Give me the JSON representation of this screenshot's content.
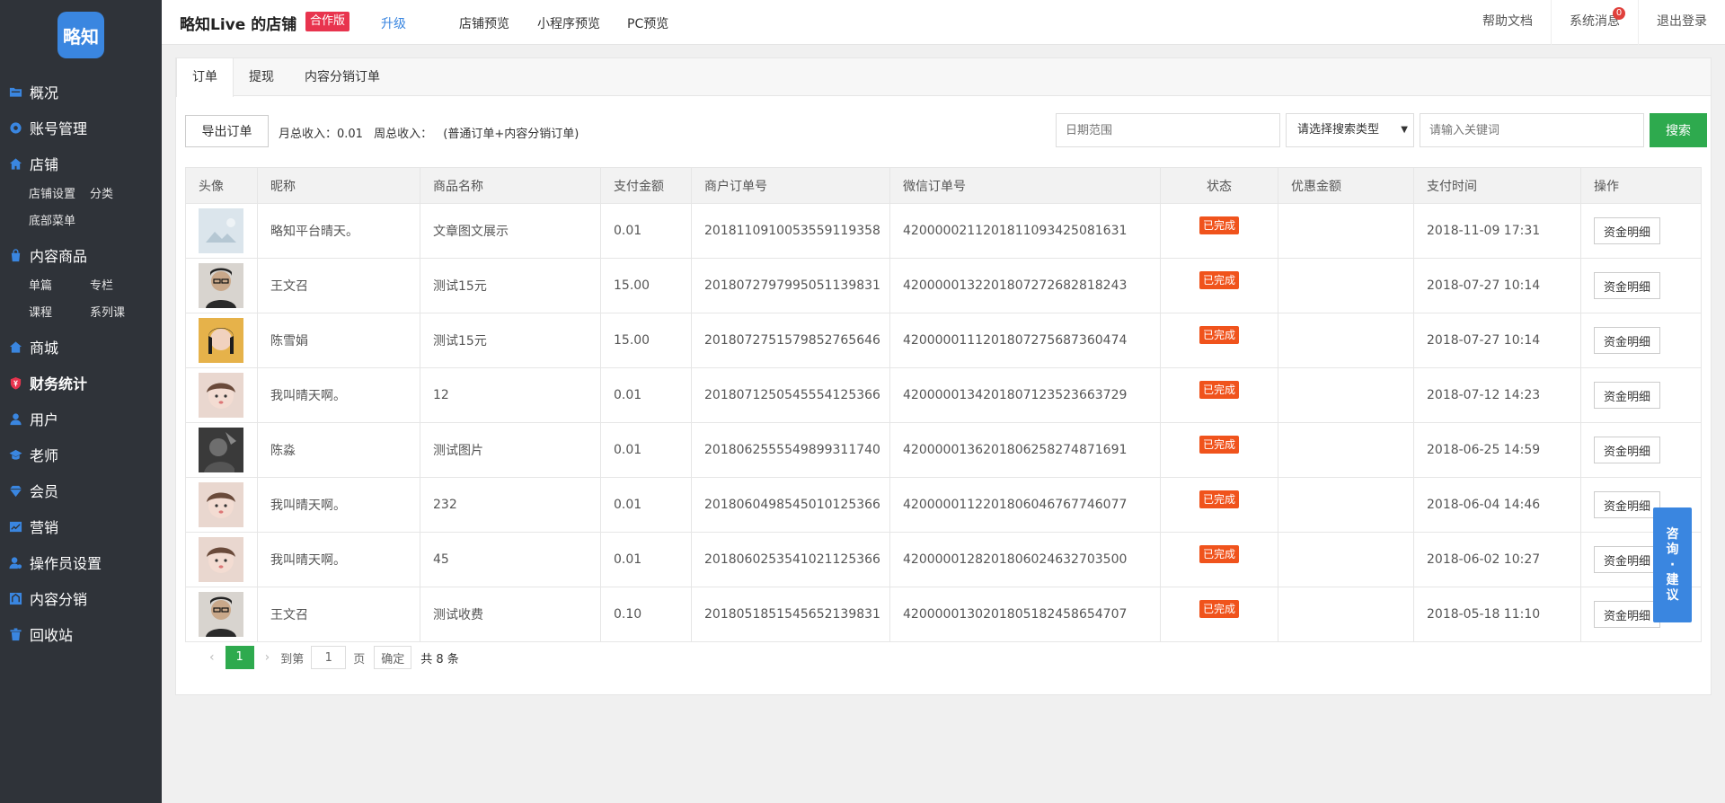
{
  "logo": {
    "text": "略知"
  },
  "sidebar": {
    "items": [
      {
        "label": "概况"
      },
      {
        "label": "账号管理"
      },
      {
        "label": "店铺"
      },
      {
        "label": "内容商品"
      },
      {
        "label": "商城"
      },
      {
        "label": "财务统计"
      },
      {
        "label": "用户"
      },
      {
        "label": "老师"
      },
      {
        "label": "会员"
      },
      {
        "label": "营销"
      },
      {
        "label": "操作员设置"
      },
      {
        "label": "内容分销"
      },
      {
        "label": "回收站"
      }
    ],
    "shop_sub": [
      "店铺设置",
      "分类",
      "底部菜单"
    ],
    "content_sub": [
      "单篇",
      "专栏",
      "课程",
      "系列课"
    ]
  },
  "header": {
    "shop_name": "略知Live 的店铺",
    "badge": "合作版",
    "upgrade": "升级",
    "nav": [
      "店铺预览",
      "小程序预览",
      "PC预览"
    ],
    "help": "帮助文档",
    "messages": "系统消息",
    "message_count": "0",
    "logout": "退出登录"
  },
  "tabs": [
    "订单",
    "提现",
    "内容分销订单"
  ],
  "toolbar": {
    "export": "导出订单",
    "monthly_income": "月总收入：0.01",
    "weekly_income": "周总收入：",
    "note": "(普通订单+内容分销订单)",
    "date_placeholder": "日期范围",
    "search_type": "请选择搜索类型",
    "keyword_placeholder": "请输入关键词",
    "search": "搜索"
  },
  "table": {
    "headers": [
      "头像",
      "昵称",
      "商品名称",
      "支付金额",
      "商户订单号",
      "微信订单号",
      "状态",
      "优惠金额",
      "支付时间",
      "操作"
    ],
    "detail_label": "资金明细",
    "rows": [
      {
        "nickname": "略知平台晴天。",
        "product": "文章图文展示",
        "amount": "0.01",
        "merchant_no": "2018110910053559119358",
        "wechat_no": "4200000211201811093425081631",
        "status": "已完成",
        "discount": "",
        "time": "2018-11-09 17:31"
      },
      {
        "nickname": "王文召",
        "product": "测试15元",
        "amount": "15.00",
        "merchant_no": "2018072797995051139831",
        "wechat_no": "4200000132201807272682818243",
        "status": "已完成",
        "discount": "",
        "time": "2018-07-27 10:14"
      },
      {
        "nickname": "陈雪娟",
        "product": "测试15元",
        "amount": "15.00",
        "merchant_no": "2018072751579852765646",
        "wechat_no": "4200000111201807275687360474",
        "status": "已完成",
        "discount": "",
        "time": "2018-07-27 10:14"
      },
      {
        "nickname": "我叫晴天啊。",
        "product": "12",
        "amount": "0.01",
        "merchant_no": "2018071250545554125366",
        "wechat_no": "4200000134201807123523663729",
        "status": "已完成",
        "discount": "",
        "time": "2018-07-12 14:23"
      },
      {
        "nickname": "陈淼",
        "product": "测试图片",
        "amount": "0.01",
        "merchant_no": "2018062555549899311740",
        "wechat_no": "4200000136201806258274871691",
        "status": "已完成",
        "discount": "",
        "time": "2018-06-25 14:59"
      },
      {
        "nickname": "我叫晴天啊。",
        "product": "232",
        "amount": "0.01",
        "merchant_no": "2018060498545010125366",
        "wechat_no": "4200000112201806046767746077",
        "status": "已完成",
        "discount": "",
        "time": "2018-06-04 14:46"
      },
      {
        "nickname": "我叫晴天啊。",
        "product": "45",
        "amount": "0.01",
        "merchant_no": "2018060253541021125366",
        "wechat_no": "4200000128201806024632703500",
        "status": "已完成",
        "discount": "",
        "time": "2018-06-02 10:27"
      },
      {
        "nickname": "王文召",
        "product": "测试收费",
        "amount": "0.10",
        "merchant_no": "2018051851545652139831",
        "wechat_no": "4200000130201805182458654707",
        "status": "已完成",
        "discount": "",
        "time": "2018-05-18 11:10"
      }
    ]
  },
  "pager": {
    "current": "1",
    "goto": "到第",
    "page_input": "1",
    "page_unit": "页",
    "confirm": "确定",
    "total": "共 8 条"
  },
  "consult": {
    "label": "咨询·建议"
  },
  "colors": {
    "sidebar_bg": "#2f3339",
    "accent_blue": "#3a86e0",
    "success_green": "#2eaa4e",
    "status_orange": "#f0531c",
    "badge_red": "#e8344e"
  }
}
